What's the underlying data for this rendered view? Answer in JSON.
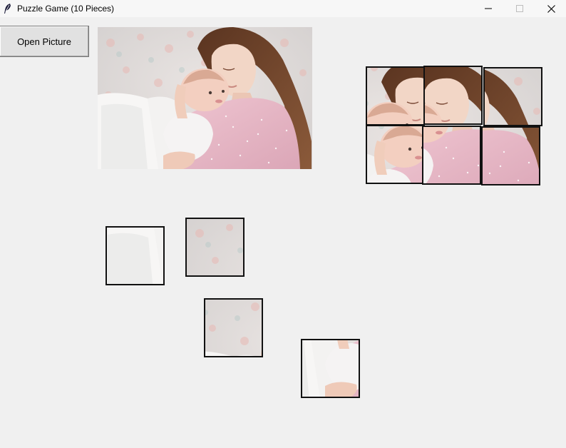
{
  "window": {
    "title": "Puzzle Game (10 Pieces)",
    "icon": "feather-icon",
    "controls": [
      "minimize-icon",
      "maximize-icon",
      "close-icon"
    ]
  },
  "toolbar": {
    "open_picture_label": "Open Picture"
  },
  "picture": {
    "description_icon": "mother-and-baby-photo"
  },
  "colors": {
    "background": "#f0f0f0",
    "piece_border": "#111111",
    "sweater": "#e8b8c6",
    "hair": "#7a4a2c",
    "skin": "#f1d3c2",
    "wallpaper": "#dcdcdc"
  }
}
